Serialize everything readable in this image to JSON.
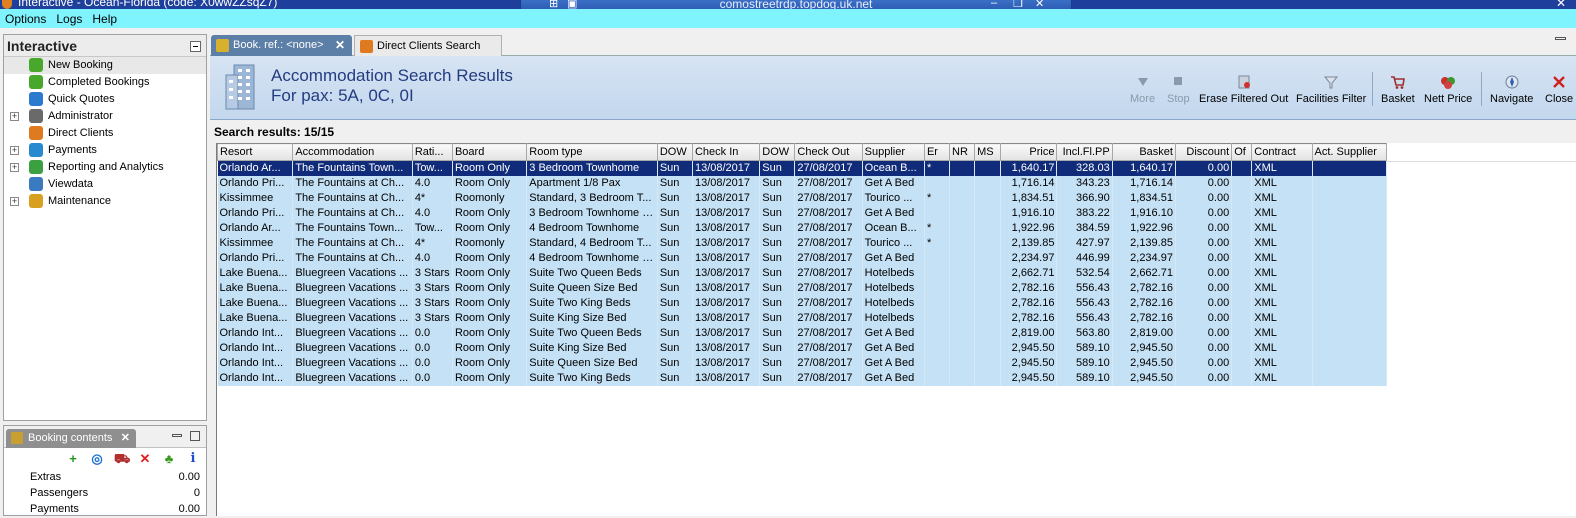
{
  "titlebar": {
    "title": "Interactive - Ocean-Florida (code: X0wwZZsqZ7)",
    "host": "comostreetrdp.topdog.uk.net"
  },
  "menu": [
    "Options",
    "Logs",
    "Help"
  ],
  "left_panel": {
    "title": "Interactive",
    "items": [
      {
        "label": "New Booking",
        "expandable": false,
        "icon": "palm-tree-icon"
      },
      {
        "label": "Completed Bookings",
        "expandable": false,
        "icon": "palm-tree-icon"
      },
      {
        "label": "Quick Quotes",
        "expandable": false,
        "icon": "clock-globe-icon"
      },
      {
        "label": "Administrator",
        "expandable": true,
        "icon": "person-icon"
      },
      {
        "label": "Direct Clients",
        "expandable": false,
        "icon": "star-person-icon"
      },
      {
        "label": "Payments",
        "expandable": true,
        "icon": "payments-icon"
      },
      {
        "label": "Reporting and Analytics",
        "expandable": true,
        "icon": "report-icon"
      },
      {
        "label": "Viewdata",
        "expandable": false,
        "icon": "viewdata-icon"
      },
      {
        "label": "Maintenance",
        "expandable": true,
        "icon": "maintenance-icon"
      }
    ]
  },
  "booking_panel": {
    "tab_label": "Booking contents",
    "rows": [
      {
        "label": "Extras",
        "value": "0.00"
      },
      {
        "label": "Passengers",
        "value": "0"
      },
      {
        "label": "Payments",
        "value": "0.00"
      }
    ]
  },
  "tabs": [
    {
      "label": "Book. ref.: <none>"
    },
    {
      "label": "Direct Clients Search"
    }
  ],
  "header": {
    "title": "Accommodation Search Results",
    "subtitle": "For pax: 5A, 0C, 0I"
  },
  "toolbar": {
    "more": "More",
    "stop": "Stop",
    "erase": "Erase Filtered Out",
    "facilities": "Facilities Filter",
    "basket": "Basket",
    "nett": "Nett Price",
    "navigate": "Navigate",
    "close": "Close"
  },
  "results_label": "Search results: 15/15",
  "columns": [
    "Resort",
    "Accommodation",
    "Rati...",
    "Board",
    "Room type",
    "DOW",
    "Check In",
    "DOW",
    "Check Out",
    "Supplier",
    "Er",
    "NR",
    "MS",
    "Price",
    "Incl.Fl.PP",
    "Basket",
    "Discount",
    "Of",
    "Contract",
    "Act. Supplier"
  ],
  "rows": [
    [
      "Orlando Ar...",
      "The Fountains Town...",
      "Tow...",
      "Room Only",
      "3 Bedroom Townhome",
      "Sun",
      "13/08/2017",
      "Sun",
      "27/08/2017",
      "Ocean B...",
      "*",
      "",
      "",
      "1,640.17",
      "328.03",
      "1,640.17",
      "0.00",
      "",
      "XML",
      ""
    ],
    [
      "Orlando Pri...",
      "The Fountains at Ch...",
      "4.0",
      "Room Only",
      "Apartment 1/8 Pax",
      "Sun",
      "13/08/2017",
      "Sun",
      "27/08/2017",
      "Get A Bed",
      "",
      "",
      "",
      "1,716.14",
      "343.23",
      "1,716.14",
      "0.00",
      "",
      "XML",
      ""
    ],
    [
      "Kissimmee",
      "The Fountains at Ch...",
      "4*",
      "Roomonly",
      "Standard, 3 Bedroom T...",
      "Sun",
      "13/08/2017",
      "Sun",
      "27/08/2017",
      "Tourico ...",
      "*",
      "",
      "",
      "1,834.51",
      "366.90",
      "1,834.51",
      "0.00",
      "",
      "XML",
      ""
    ],
    [
      "Orlando Pri...",
      "The Fountains at Ch...",
      "4.0",
      "Room Only",
      "3 Bedroom Townhome -...",
      "Sun",
      "13/08/2017",
      "Sun",
      "27/08/2017",
      "Get A Bed",
      "",
      "",
      "",
      "1,916.10",
      "383.22",
      "1,916.10",
      "0.00",
      "",
      "XML",
      ""
    ],
    [
      "Orlando Ar...",
      "The Fountains Town...",
      "Tow...",
      "Room Only",
      "4 Bedroom Townhome",
      "Sun",
      "13/08/2017",
      "Sun",
      "27/08/2017",
      "Ocean B...",
      "*",
      "",
      "",
      "1,922.96",
      "384.59",
      "1,922.96",
      "0.00",
      "",
      "XML",
      ""
    ],
    [
      "Kissimmee",
      "The Fountains at Ch...",
      "4*",
      "Roomonly",
      "Standard, 4 Bedroom T...",
      "Sun",
      "13/08/2017",
      "Sun",
      "27/08/2017",
      "Tourico ...",
      "*",
      "",
      "",
      "2,139.85",
      "427.97",
      "2,139.85",
      "0.00",
      "",
      "XML",
      ""
    ],
    [
      "Orlando Pri...",
      "The Fountains at Ch...",
      "4.0",
      "Room Only",
      "4 Bedroom Townhome -...",
      "Sun",
      "13/08/2017",
      "Sun",
      "27/08/2017",
      "Get A Bed",
      "",
      "",
      "",
      "2,234.97",
      "446.99",
      "2,234.97",
      "0.00",
      "",
      "XML",
      ""
    ],
    [
      "Lake Buena...",
      "Bluegreen Vacations ...",
      "3 Stars",
      "Room Only",
      "Suite Two Queen Beds",
      "Sun",
      "13/08/2017",
      "Sun",
      "27/08/2017",
      "Hotelbeds",
      "",
      "",
      "",
      "2,662.71",
      "532.54",
      "2,662.71",
      "0.00",
      "",
      "XML",
      ""
    ],
    [
      "Lake Buena...",
      "Bluegreen Vacations ...",
      "3 Stars",
      "Room Only",
      "Suite Queen Size Bed",
      "Sun",
      "13/08/2017",
      "Sun",
      "27/08/2017",
      "Hotelbeds",
      "",
      "",
      "",
      "2,782.16",
      "556.43",
      "2,782.16",
      "0.00",
      "",
      "XML",
      ""
    ],
    [
      "Lake Buena...",
      "Bluegreen Vacations ...",
      "3 Stars",
      "Room Only",
      "Suite Two King Beds",
      "Sun",
      "13/08/2017",
      "Sun",
      "27/08/2017",
      "Hotelbeds",
      "",
      "",
      "",
      "2,782.16",
      "556.43",
      "2,782.16",
      "0.00",
      "",
      "XML",
      ""
    ],
    [
      "Lake Buena...",
      "Bluegreen Vacations ...",
      "3 Stars",
      "Room Only",
      "Suite King Size Bed",
      "Sun",
      "13/08/2017",
      "Sun",
      "27/08/2017",
      "Hotelbeds",
      "",
      "",
      "",
      "2,782.16",
      "556.43",
      "2,782.16",
      "0.00",
      "",
      "XML",
      ""
    ],
    [
      "Orlando Int...",
      "Bluegreen Vacations ...",
      "0.0",
      "Room Only",
      "Suite Two Queen Beds",
      "Sun",
      "13/08/2017",
      "Sun",
      "27/08/2017",
      "Get A Bed",
      "",
      "",
      "",
      "2,819.00",
      "563.80",
      "2,819.00",
      "0.00",
      "",
      "XML",
      ""
    ],
    [
      "Orlando Int...",
      "Bluegreen Vacations ...",
      "0.0",
      "Room Only",
      "Suite King Size Bed",
      "Sun",
      "13/08/2017",
      "Sun",
      "27/08/2017",
      "Get A Bed",
      "",
      "",
      "",
      "2,945.50",
      "589.10",
      "2,945.50",
      "0.00",
      "",
      "XML",
      ""
    ],
    [
      "Orlando Int...",
      "Bluegreen Vacations ...",
      "0.0",
      "Room Only",
      "Suite Queen Size Bed",
      "Sun",
      "13/08/2017",
      "Sun",
      "27/08/2017",
      "Get A Bed",
      "",
      "",
      "",
      "2,945.50",
      "589.10",
      "2,945.50",
      "0.00",
      "",
      "XML",
      ""
    ],
    [
      "Orlando Int...",
      "Bluegreen Vacations ...",
      "0.0",
      "Room Only",
      "Suite Two King Beds",
      "Sun",
      "13/08/2017",
      "Sun",
      "27/08/2017",
      "Get A Bed",
      "",
      "",
      "",
      "2,945.50",
      "589.10",
      "2,945.50",
      "0.00",
      "",
      "XML",
      ""
    ]
  ],
  "colors": {
    "menubar": "#7ff4ff",
    "selected_row": "#0f2b7a",
    "row": "#c5e1f5",
    "banner_text": "#233c80"
  }
}
